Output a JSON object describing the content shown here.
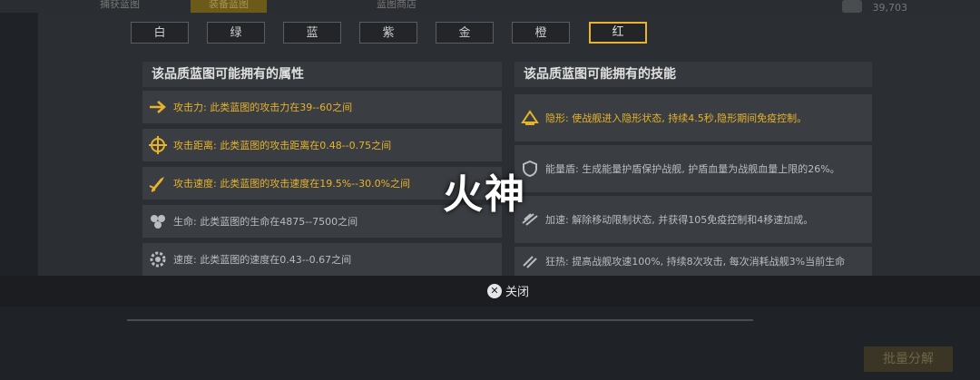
{
  "background": {
    "tabs": [
      "捕获蓝图",
      "装备蓝图",
      "蓝图商店"
    ],
    "currency": "39,703",
    "bulk_button": "批量分解"
  },
  "quality_tabs": [
    {
      "label": "白",
      "active": false
    },
    {
      "label": "绿",
      "active": false
    },
    {
      "label": "蓝",
      "active": false
    },
    {
      "label": "紫",
      "active": false
    },
    {
      "label": "金",
      "active": false
    },
    {
      "label": "橙",
      "active": false
    },
    {
      "label": "红",
      "active": true
    }
  ],
  "attributes": {
    "heading": "该品质蓝图可能拥有的属性",
    "items": [
      {
        "icon": "arrow-icon",
        "text": "攻击力: 此类蓝图的攻击力在39--60之间",
        "color": "#e6b32c"
      },
      {
        "icon": "crosshair-icon",
        "text": "攻击距离: 此类蓝图的攻击距离在0.48--0.75之间",
        "color": "#e6b32c"
      },
      {
        "icon": "rocket-icon",
        "text": "攻击速度: 此类蓝图的攻击速度在19.5%--30.0%之间",
        "color": "#e6b32c"
      },
      {
        "icon": "hexagons-icon",
        "text": "生命: 此类蓝图的生命在4875--7500之间",
        "color": "#b9bcc0"
      },
      {
        "icon": "gear-icon",
        "text": "速度: 此类蓝图的速度在0.43--0.67之间",
        "color": "#b9bcc0"
      }
    ]
  },
  "skills": {
    "heading": "该品质蓝图可能拥有的技能",
    "items": [
      {
        "icon": "stealth-icon",
        "text": "隐形: 使战舰进入隐形状态, 持续4.5秒,隐形期间免疫控制。",
        "color": "#e6b32c"
      },
      {
        "icon": "shield-icon",
        "text": "能量盾: 生成能量护盾保护战舰, 护盾血量为战舰血量上限的26%。",
        "color": "#b9bcc0"
      },
      {
        "icon": "speed-icon",
        "text": "加速: 解除移动限制状态, 并获得105免疫控制和4移速加成。",
        "color": "#b9bcc0"
      },
      {
        "icon": "frenzy-icon",
        "text": "狂热: 提高战舰攻速100%, 持续8次攻击, 每次消耗战舰3%当前生命",
        "color": "#b9bcc0"
      }
    ]
  },
  "overlay_title": "火神",
  "close_label": "关闭"
}
